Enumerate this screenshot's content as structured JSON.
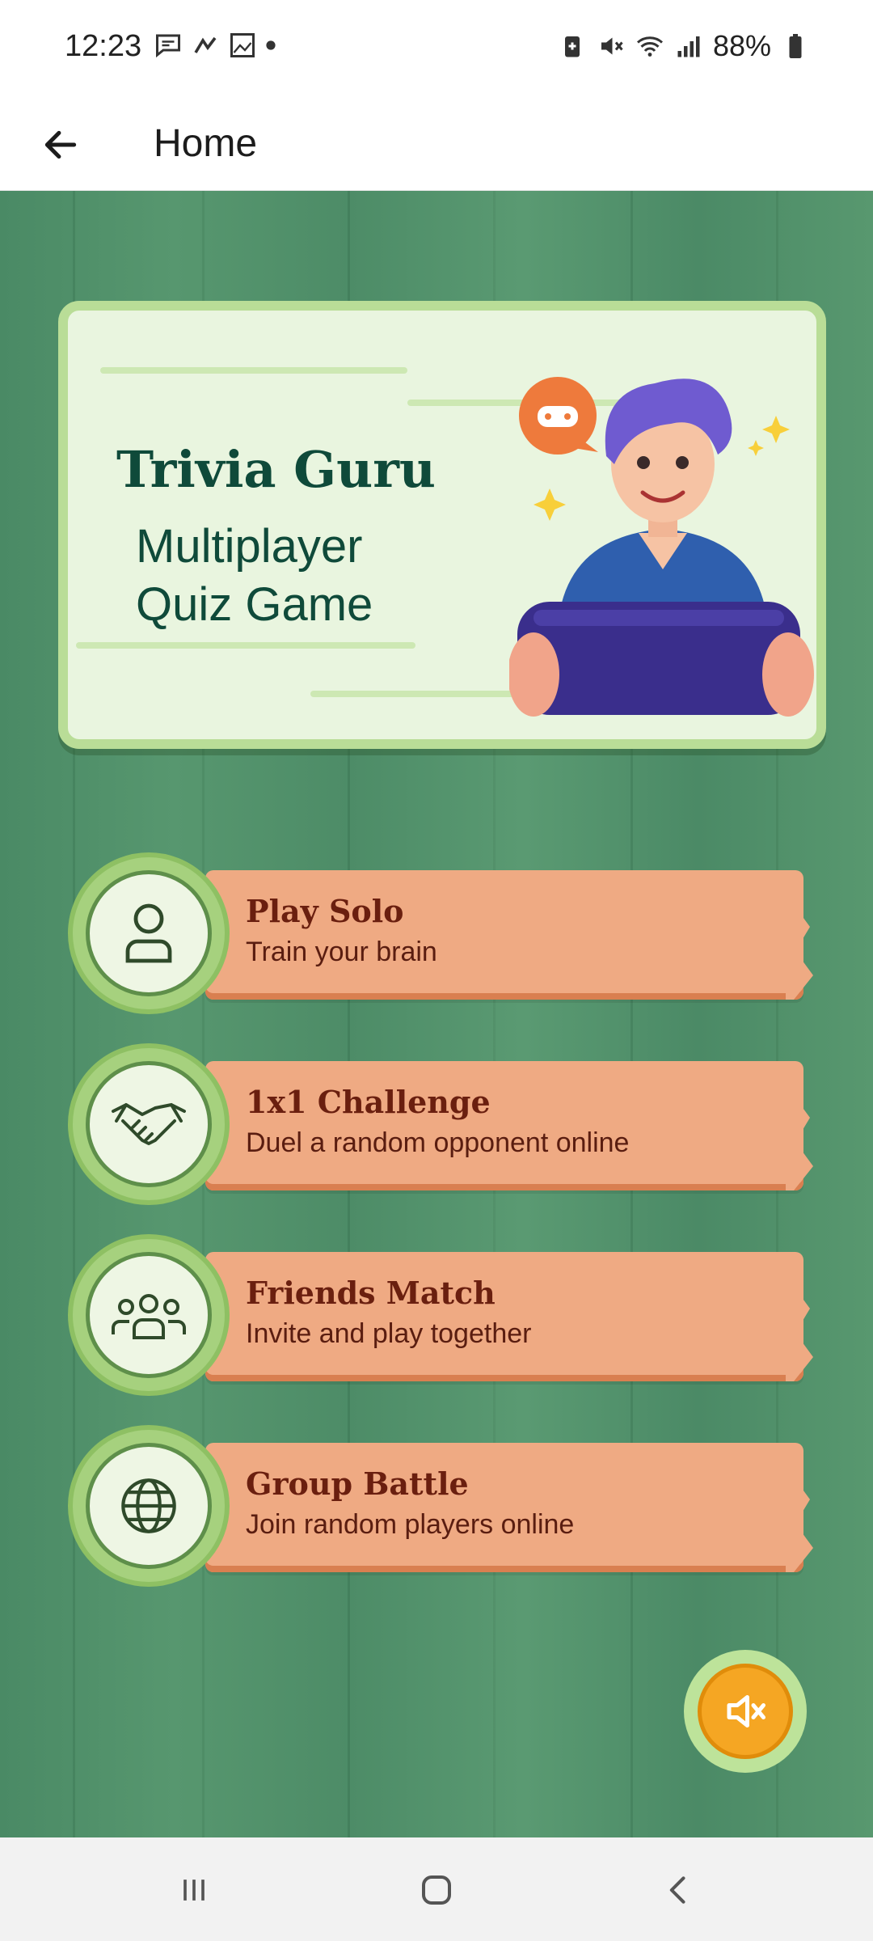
{
  "status_bar": {
    "time": "12:23",
    "battery": "88%",
    "left_icons": [
      "message-icon",
      "arrow-icon",
      "app-icon",
      "dot-icon"
    ],
    "right_icons": [
      "battery-saver-icon",
      "mute-icon",
      "wifi-icon",
      "signal-icon",
      "battery-icon"
    ]
  },
  "app_bar": {
    "title": "Home",
    "back_icon": "back-arrow-icon"
  },
  "banner": {
    "title": "Trivia Guru",
    "subtitle_line1": "Multiplayer",
    "subtitle_line2": "Quiz Game"
  },
  "menu": {
    "items": [
      {
        "title": "Play Solo",
        "subtitle": "Train your brain",
        "icon": "person-icon"
      },
      {
        "title": "1x1 Challenge",
        "subtitle": "Duel a random opponent online",
        "icon": "handshake-icon"
      },
      {
        "title": "Friends Match",
        "subtitle": "Invite and play together",
        "icon": "group-icon"
      },
      {
        "title": "Group Battle",
        "subtitle": "Join random players online",
        "icon": "globe-icon"
      }
    ]
  },
  "mute_button": {
    "icon": "sound-muted-icon"
  },
  "colors": {
    "wood_bg": "#4f8f6a",
    "banner_bg": "#e9f5df",
    "plank": "#efaa83",
    "title_green": "#0f4a3a",
    "menu_title": "#6a1f0f",
    "mute_orange": "#f5a623"
  }
}
